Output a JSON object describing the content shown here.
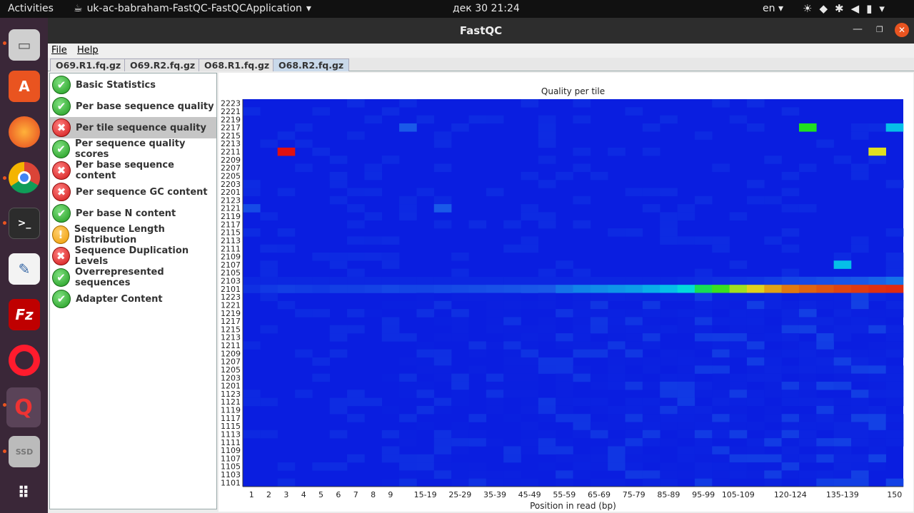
{
  "topbar": {
    "activities": "Activities",
    "app_name": "uk-ac-babraham-FastQC-FastQCApplication",
    "clock": "дек 30  21:24",
    "lang": "en"
  },
  "dock": {
    "items": [
      "files-icon",
      "software-icon",
      "firefox-icon",
      "chrome-icon",
      "terminal-icon",
      "text-editor-icon",
      "filezilla-icon",
      "opera-icon",
      "fastqc-icon",
      "ssd-icon",
      "app-grid-icon"
    ]
  },
  "window": {
    "title": "FastQC",
    "menu": {
      "file": "File",
      "help": "Help"
    },
    "tabs": [
      "O69.R1.fq.gz",
      "O69.R2.fq.gz",
      "O68.R1.fq.gz",
      "O68.R2.fq.gz"
    ],
    "active_tab": 3
  },
  "modules": [
    {
      "label": "Basic Statistics",
      "status": "pass"
    },
    {
      "label": "Per base sequence quality",
      "status": "pass"
    },
    {
      "label": "Per tile sequence quality",
      "status": "fail"
    },
    {
      "label": "Per sequence quality scores",
      "status": "pass"
    },
    {
      "label": "Per base sequence content",
      "status": "fail"
    },
    {
      "label": "Per sequence GC content",
      "status": "fail"
    },
    {
      "label": "Per base N content",
      "status": "pass"
    },
    {
      "label": "Sequence Length Distribution",
      "status": "warn"
    },
    {
      "label": "Sequence Duplication Levels",
      "status": "fail"
    },
    {
      "label": "Overrepresented sequences",
      "status": "pass"
    },
    {
      "label": "Adapter Content",
      "status": "pass"
    }
  ],
  "selected_module": 2,
  "chart_data": {
    "type": "heatmap",
    "title": "Quality per tile",
    "xlabel": "Position in read (bp)",
    "ylabel": "",
    "x": [
      "1",
      "2",
      "3",
      "4",
      "5",
      "6",
      "7",
      "8",
      "9",
      "10-14",
      "15-19",
      "20-24",
      "25-29",
      "30-34",
      "35-39",
      "40-44",
      "45-49",
      "50-54",
      "55-59",
      "60-64",
      "65-69",
      "70-74",
      "75-79",
      "80-84",
      "85-89",
      "90-94",
      "95-99",
      "100-104",
      "105-109",
      "110-114",
      "115-119",
      "120-124",
      "125-129",
      "130-134",
      "135-139",
      "140-144",
      "145-149",
      "150"
    ],
    "x_tick_labels": [
      "1",
      "2",
      "3",
      "4",
      "5",
      "6",
      "7",
      "8",
      "9",
      "",
      "15-19",
      "",
      "25-29",
      "",
      "35-39",
      "",
      "45-49",
      "",
      "55-59",
      "",
      "65-69",
      "",
      "75-79",
      "",
      "85-89",
      "",
      "95-99",
      "",
      "105-109",
      "",
      "",
      "120-124",
      "",
      "",
      "135-139",
      "",
      "",
      "150"
    ],
    "y": [
      "2223",
      "2221",
      "2219",
      "2217",
      "2215",
      "2213",
      "2211",
      "2209",
      "2207",
      "2205",
      "2203",
      "2201",
      "2123",
      "2121",
      "2119",
      "2117",
      "2115",
      "2113",
      "2111",
      "2109",
      "2107",
      "2105",
      "2103",
      "2101",
      "1223",
      "1221",
      "1219",
      "1217",
      "1215",
      "1213",
      "1211",
      "1209",
      "1207",
      "1205",
      "1203",
      "1201",
      "1123",
      "1121",
      "1119",
      "1117",
      "1115",
      "1113",
      "1111",
      "1109",
      "1107",
      "1105",
      "1103",
      "1101"
    ],
    "value_range": [
      0,
      10
    ],
    "colors": {
      "low": "#0a1ee0",
      "mid": "#00d8e8",
      "high": "#e01010"
    },
    "highlights": [
      {
        "tile": "2211",
        "pos": "3",
        "value": 10
      },
      {
        "tile": "2211",
        "pos": "145-149",
        "value": 6.5
      },
      {
        "tile": "2217",
        "pos": "125-129",
        "value": 5
      },
      {
        "tile": "2107",
        "pos": "135-139",
        "value": 3.2
      },
      {
        "tile": "2217",
        "pos": "10-14",
        "value": 2
      },
      {
        "tile": "2121",
        "pos": "1",
        "value": 1.5
      },
      {
        "tile": "2121",
        "pos": "20-24",
        "value": 2
      },
      {
        "tile": "2217",
        "pos": "150",
        "value": 3.2
      }
    ],
    "band_tile": "2101",
    "band_values": [
      0.6,
      0.9,
      1.1,
      1.0,
      0.9,
      1.1,
      1.1,
      1.2,
      1.4,
      1.3,
      1.3,
      1.4,
      1.5,
      1.6,
      1.7,
      1.8,
      1.9,
      2.0,
      2.3,
      2.5,
      2.6,
      2.7,
      2.8,
      3.0,
      3.2,
      3.6,
      4.6,
      5.2,
      6.0,
      6.7,
      7.4,
      8.0,
      8.4,
      8.7,
      9.0,
      9.2,
      9.4,
      9.5
    ],
    "band_upper_values": [
      0.3,
      0.3,
      0.3,
      0.3,
      0.3,
      0.3,
      0.3,
      0.3,
      0.3,
      0.3,
      0.3,
      0.3,
      0.3,
      0.3,
      0.3,
      0.3,
      0.3,
      0.3,
      0.3,
      0.3,
      0.3,
      0.3,
      0.3,
      0.3,
      0.3,
      0.4,
      0.5,
      0.6,
      0.7,
      0.8,
      1.0,
      1.3,
      1.4,
      1.6,
      1.8,
      1.9,
      2.1,
      2.3
    ]
  }
}
